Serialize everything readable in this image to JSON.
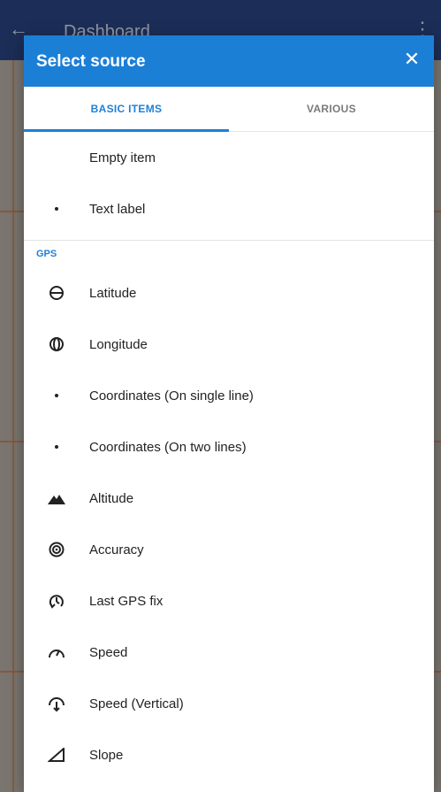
{
  "background": {
    "title": "Dashboard",
    "back_icon": "back-arrow-icon",
    "more_icon": "more-vert-icon"
  },
  "dialog": {
    "title": "Select source",
    "close_icon": "close-icon",
    "header_color": "#1c7fd6"
  },
  "tabs": [
    {
      "label": "BASIC ITEMS",
      "active": true
    },
    {
      "label": "VARIOUS",
      "active": false
    }
  ],
  "basic_items": [
    {
      "label": "Empty item",
      "icon": "none"
    },
    {
      "label": "Text label",
      "icon": "bullet-icon"
    }
  ],
  "gps_section": {
    "title": "GPS",
    "items": [
      {
        "label": "Latitude",
        "icon": "latitude-icon"
      },
      {
        "label": "Longitude",
        "icon": "longitude-icon"
      },
      {
        "label": "Coordinates (On single line)",
        "icon": "bullet-icon"
      },
      {
        "label": "Coordinates (On two lines)",
        "icon": "bullet-icon"
      },
      {
        "label": "Altitude",
        "icon": "mountain-icon"
      },
      {
        "label": "Accuracy",
        "icon": "target-icon"
      },
      {
        "label": "Last GPS fix",
        "icon": "gps-fix-icon"
      },
      {
        "label": "Speed",
        "icon": "speedometer-icon"
      },
      {
        "label": "Speed (Vertical)",
        "icon": "vertical-speed-icon"
      },
      {
        "label": "Slope",
        "icon": "slope-icon"
      }
    ]
  }
}
